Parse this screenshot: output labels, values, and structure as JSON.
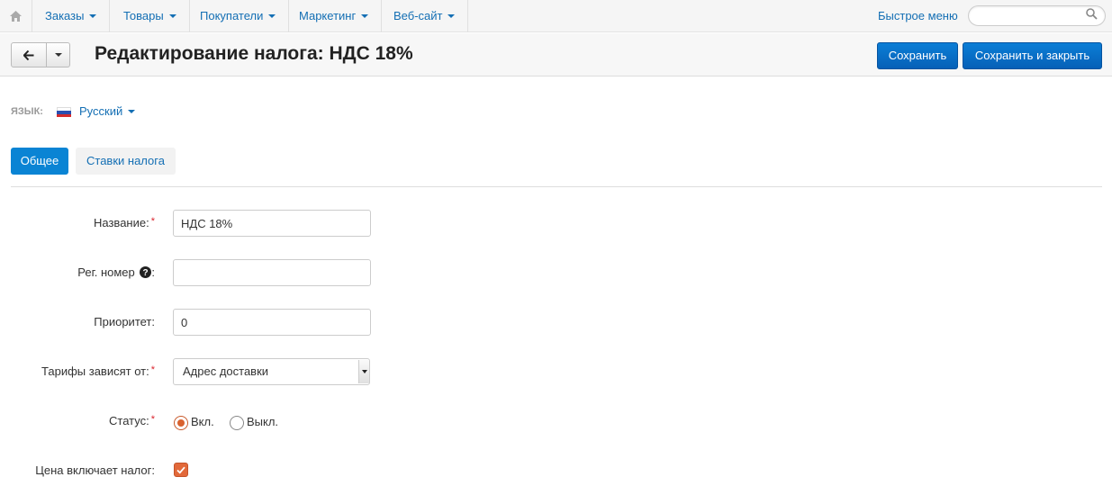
{
  "nav": {
    "items": [
      {
        "label": "Заказы"
      },
      {
        "label": "Товары"
      },
      {
        "label": "Покупатели"
      },
      {
        "label": "Маркетинг"
      },
      {
        "label": "Веб-сайт"
      }
    ],
    "quick_menu": "Быстрое меню",
    "search_placeholder": ""
  },
  "toolbar": {
    "title": "Редактирование налога: НДС 18%",
    "save_label": "Сохранить",
    "save_close_label": "Сохранить и закрыть"
  },
  "language": {
    "label": "ЯЗЫК:",
    "value": "Русский"
  },
  "tabs": [
    {
      "label": "Общее",
      "active": true
    },
    {
      "label": "Ставки налога",
      "active": false
    }
  ],
  "form": {
    "name_label": "Название:",
    "name_value": "НДС 18%",
    "reg_label": "Рег. номер",
    "reg_suffix": ":",
    "reg_value": "",
    "priority_label": "Приоритет:",
    "priority_value": "0",
    "rates_label": "Тарифы зависят от:",
    "rates_value": "Адрес доставки",
    "status_label": "Статус:",
    "status_on": "Вкл.",
    "status_off": "Выкл.",
    "status_selected": "Вкл.",
    "price_includes_label": "Цена включает налог:",
    "price_includes_checked": true
  },
  "colors": {
    "link": "#146fb4",
    "primary": "#0a84d4",
    "required": "#d9232d",
    "accent": "#e2693a"
  },
  "icons": [
    "home-icon",
    "search-icon",
    "arrow-left-icon",
    "question-circle-icon",
    "check-icon"
  ]
}
